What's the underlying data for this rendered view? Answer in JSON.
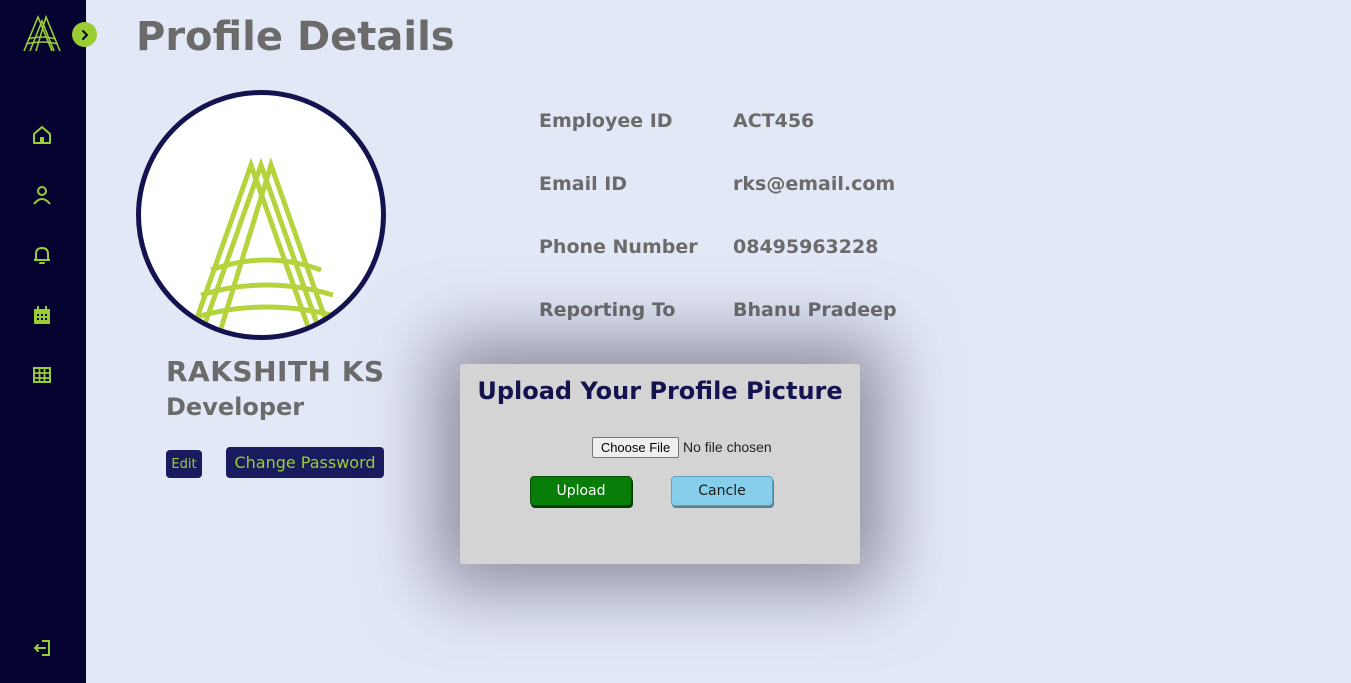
{
  "page": {
    "title": "Profile Details"
  },
  "sidebar": {
    "logo_icon": "a-logo-icon",
    "expand_icon": "chevron-right-icon",
    "items": [
      {
        "icon": "home-icon"
      },
      {
        "icon": "user-icon"
      },
      {
        "icon": "bell-icon"
      },
      {
        "icon": "calendar-icon"
      },
      {
        "icon": "grid-icon"
      }
    ],
    "logout_icon": "logout-icon"
  },
  "profile": {
    "name": "RAKSHITH KS",
    "role": "Developer",
    "edit_label": "Edit",
    "change_password_label": "Change Password"
  },
  "details": [
    {
      "label": "Employee ID",
      "value": "ACT456"
    },
    {
      "label": "Email ID",
      "value": "rks@email.com"
    },
    {
      "label": "Phone Number",
      "value": "08495963228"
    },
    {
      "label": "Reporting To",
      "value": "Bhanu Pradeep"
    }
  ],
  "modal": {
    "title": "Upload Your Profile Picture",
    "choose_file_label": "Choose File",
    "file_status": "No file chosen",
    "upload_label": "Upload",
    "cancel_label": "Cancle"
  },
  "colors": {
    "sidebar_bg": "#05032f",
    "accent": "#9acd32",
    "page_bg": "#e3e8f7",
    "dark_button": "#1a1a5e"
  }
}
